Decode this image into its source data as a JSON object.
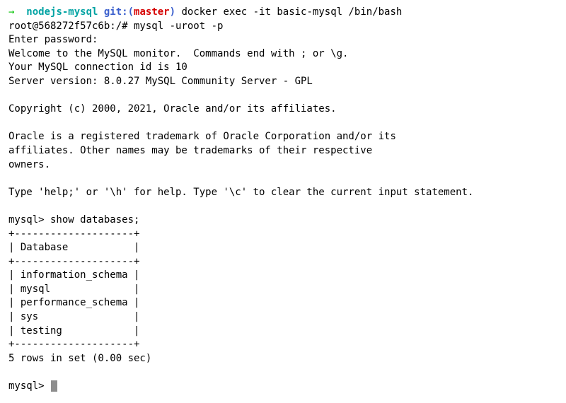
{
  "prompt1": {
    "arrow": "→  ",
    "dir": "nodejs-mysql",
    "git_prefix": " git:(",
    "branch": "master",
    "git_suffix": ")",
    "command": " docker exec -it basic-mysql /bin/bash"
  },
  "line2": "root@568272f57c6b:/# mysql -uroot -p",
  "line3": "Enter password:",
  "line4": "Welcome to the MySQL monitor.  Commands end with ; or \\g.",
  "line5": "Your MySQL connection id is 10",
  "line6": "Server version: 8.0.27 MySQL Community Server - GPL",
  "blank": " ",
  "line8": "Copyright (c) 2000, 2021, Oracle and/or its affiliates.",
  "line10": "Oracle is a registered trademark of Oracle Corporation and/or its",
  "line11": "affiliates. Other names may be trademarks of their respective",
  "line12": "owners.",
  "line14": "Type 'help;' or '\\h' for help. Type '\\c' to clear the current input statement.",
  "line16": "mysql> show databases;",
  "table": {
    "border": "+--------------------+",
    "header": "| Database           |",
    "rows": [
      "| information_schema |",
      "| mysql              |",
      "| performance_schema |",
      "| sys                |",
      "| testing            |"
    ]
  },
  "line_summary": "5 rows in set (0.00 sec)",
  "final_prompt": "mysql> "
}
